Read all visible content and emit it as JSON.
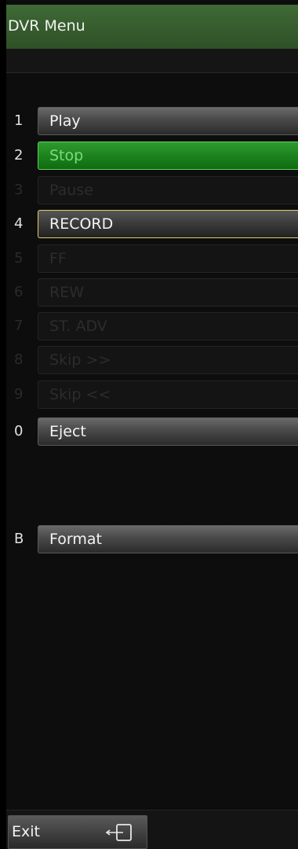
{
  "title": "DVR Menu",
  "items": [
    {
      "key": "1",
      "label": "Play",
      "state": "normal"
    },
    {
      "key": "2",
      "label": "Stop",
      "state": "active"
    },
    {
      "key": "3",
      "label": "Pause",
      "state": "disabled"
    },
    {
      "key": "4",
      "label": "RECORD",
      "state": "selected"
    },
    {
      "key": "5",
      "label": "FF",
      "state": "disabled"
    },
    {
      "key": "6",
      "label": "REW",
      "state": "disabled"
    },
    {
      "key": "7",
      "label": "ST. ADV",
      "state": "disabled"
    },
    {
      "key": "8",
      "label": "Skip >>",
      "state": "disabled"
    },
    {
      "key": "9",
      "label": "Skip <<",
      "state": "disabled"
    },
    {
      "key": "0",
      "label": "Eject",
      "state": "normal"
    },
    {
      "key": "B",
      "label": "Format",
      "state": "normal"
    }
  ],
  "footer": {
    "exit_label": "Exit",
    "exit_icon": "exit-icon"
  },
  "colors": {
    "title_bar": "#3f6a35",
    "active_button": "#1f861f",
    "selected_border": "#e0cf6a"
  }
}
